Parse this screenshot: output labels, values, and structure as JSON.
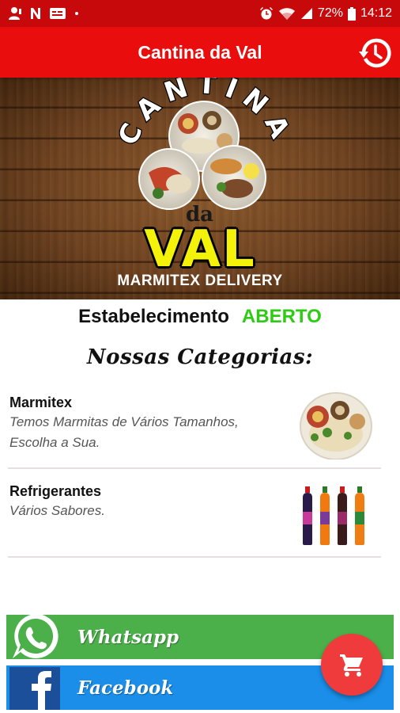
{
  "status_bar": {
    "battery_percent": "72%",
    "time": "14:12",
    "left_icons": [
      "person-icon",
      "n-icon",
      "cc-icon",
      "dot-icon"
    ],
    "right_icons": [
      "alarm-icon",
      "wifi-icon",
      "signal-icon",
      "battery-icon"
    ]
  },
  "app_bar": {
    "title": "Cantina da Val",
    "action_icon": "history-icon"
  },
  "banner": {
    "arc_text": "CANTINA",
    "da_text": "da",
    "big_text": "VAL",
    "subtitle": "MARMITEX DELIVERY"
  },
  "establishment": {
    "label": "Estabelecimento",
    "status": "ABERTO",
    "status_color": "#2ecb14"
  },
  "categories_title": "Nossas Categorias:",
  "categories": [
    {
      "name": "Marmitex",
      "description": "Temos Marmitas de Vários Tamanhos, Escolha a Sua.",
      "image_icon": "food-plate-icon"
    },
    {
      "name": "Refrigerantes",
      "description": "Vários Sabores.",
      "image_icon": "soda-bottles-icon"
    }
  ],
  "social": {
    "whatsapp_label": "Whatsapp",
    "facebook_label": "Facebook",
    "whatsapp_color": "#4bb04a",
    "facebook_color": "#1a8ee9"
  },
  "fab": {
    "icon": "cart-icon",
    "color": "#ef3b3b"
  },
  "colors": {
    "primary": "#ea0d0d",
    "status_bar": "#c8090b"
  }
}
